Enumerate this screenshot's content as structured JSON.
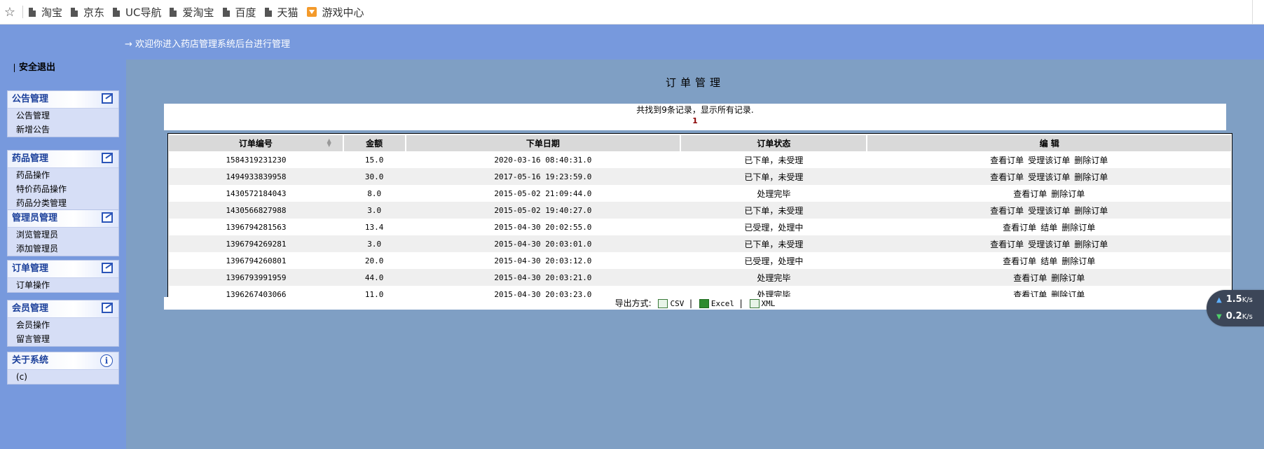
{
  "bookmarks": {
    "items": [
      {
        "label": "淘宝",
        "icon": "file-icon"
      },
      {
        "label": "京东",
        "icon": "file-icon"
      },
      {
        "label": "UC导航",
        "icon": "file-icon"
      },
      {
        "label": "爱淘宝",
        "icon": "file-icon"
      },
      {
        "label": "百度",
        "icon": "file-icon"
      },
      {
        "label": "天猫",
        "icon": "file-icon"
      },
      {
        "label": "游戏中心",
        "icon": "game-icon"
      }
    ]
  },
  "header": {
    "welcome": "→ 欢迎你进入药店管理系统后台进行管理"
  },
  "sidebar": {
    "logout": "安全退出",
    "menus": [
      {
        "title": "公告管理",
        "items": [
          "公告管理",
          "新增公告"
        ]
      },
      {
        "title": "药品管理",
        "items": [
          "药品操作",
          "特价药品操作",
          "药品分类管理"
        ]
      },
      {
        "title": "管理员管理",
        "items": [
          "浏览管理员",
          "添加管理员"
        ]
      },
      {
        "title": "订单管理",
        "items": [
          "订单操作"
        ]
      },
      {
        "title": "会员管理",
        "items": [
          "会员操作",
          "留言管理"
        ]
      },
      {
        "title": "关于系统",
        "items": [
          "(c)"
        ]
      }
    ]
  },
  "main": {
    "title": "订单管理",
    "record_info": "共找到9条记录，显示所有记录.",
    "page": "1",
    "columns": [
      "订单编号",
      "金额",
      "下单日期",
      "订单状态",
      "编 辑"
    ],
    "rows": [
      {
        "id": "1584319231230",
        "amount": "15.0",
        "date": "2020-03-16 08:40:31.0",
        "status": "已下单，未受理",
        "actions": [
          "查看订单",
          "受理该订单",
          "删除订单"
        ]
      },
      {
        "id": "1494933839958",
        "amount": "30.0",
        "date": "2017-05-16 19:23:59.0",
        "status": "已下单，未受理",
        "actions": [
          "查看订单",
          "受理该订单",
          "删除订单"
        ]
      },
      {
        "id": "1430572184043",
        "amount": "8.0",
        "date": "2015-05-02 21:09:44.0",
        "status": "处理完毕",
        "actions": [
          "查看订单",
          "删除订单"
        ]
      },
      {
        "id": "1430566827988",
        "amount": "3.0",
        "date": "2015-05-02 19:40:27.0",
        "status": "已下单，未受理",
        "actions": [
          "查看订单",
          "受理该订单",
          "删除订单"
        ]
      },
      {
        "id": "1396794281563",
        "amount": "13.4",
        "date": "2015-04-30 20:02:55.0",
        "status": "已受理，处理中",
        "actions": [
          "查看订单",
          "结单",
          "删除订单"
        ]
      },
      {
        "id": "1396794269281",
        "amount": "3.0",
        "date": "2015-04-30 20:03:01.0",
        "status": "已下单，未受理",
        "actions": [
          "查看订单",
          "受理该订单",
          "删除订单"
        ]
      },
      {
        "id": "1396794260801",
        "amount": "20.0",
        "date": "2015-04-30 20:03:12.0",
        "status": "已受理，处理中",
        "actions": [
          "查看订单",
          "结单",
          "删除订单"
        ]
      },
      {
        "id": "1396793991959",
        "amount": "44.0",
        "date": "2015-04-30 20:03:21.0",
        "status": "处理完毕",
        "actions": [
          "查看订单",
          "删除订单"
        ]
      },
      {
        "id": "1396267403066",
        "amount": "11.0",
        "date": "2015-04-30 20:03:23.0",
        "status": "处理完毕",
        "actions": [
          "查看订单",
          "删除订单"
        ]
      }
    ],
    "export": {
      "label": "导出方式:",
      "options": [
        "CSV",
        "Excel",
        "XML"
      ]
    }
  },
  "speed_widget": {
    "up_value": "1.5",
    "up_unit": "K/s",
    "down_value": "0.2",
    "down_unit": "K/s"
  },
  "colors": {
    "banner": "#7799dd",
    "content_bg": "#7f9fc4",
    "menu_title": "#1a3f9a"
  }
}
